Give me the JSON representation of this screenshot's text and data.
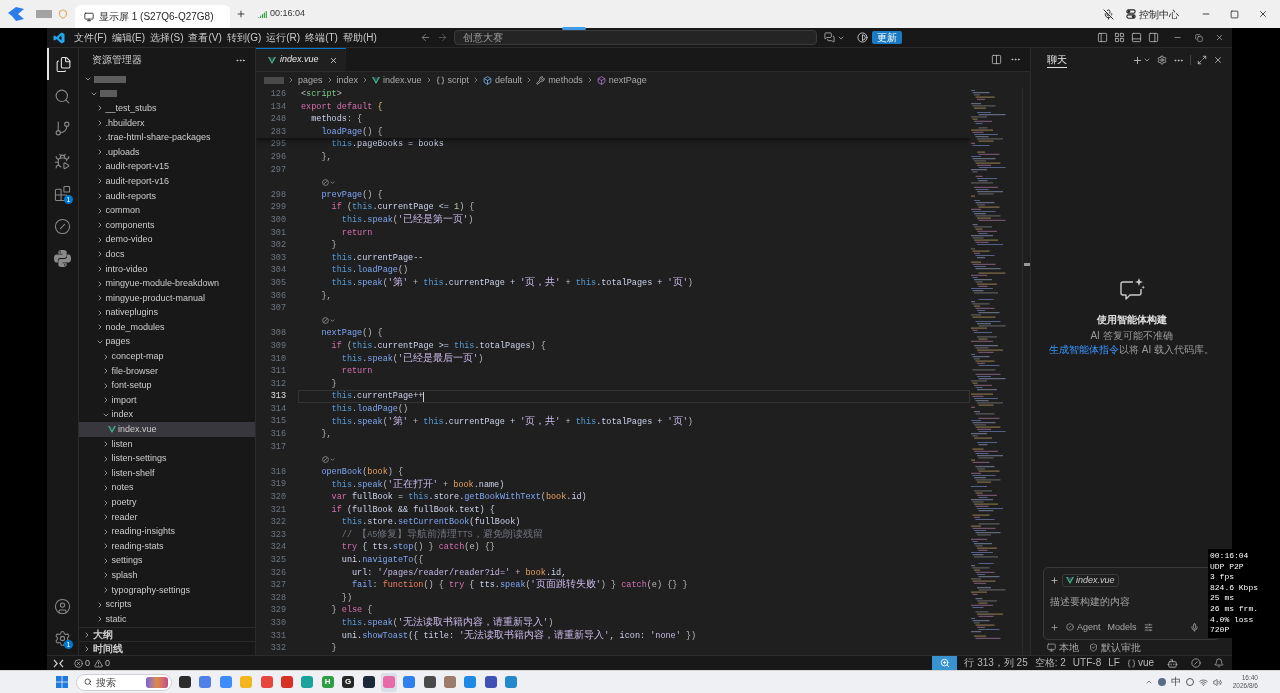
{
  "remote_bar": {
    "tabs": [
      {
        "label": "显示屏 1 (S27Q6-Q27G8)",
        "selected": true
      }
    ],
    "session_time": "00:16:04",
    "control_center": "控制中心"
  },
  "title_bar": {
    "menus": [
      "文件(F)",
      "编辑(E)",
      "选择(S)",
      "查看(V)",
      "转到(G)",
      "运行(R)",
      "终端(T)",
      "帮助(H)"
    ],
    "command_center": "创意大赛",
    "update_button": "更新"
  },
  "activity_bar": {
    "items": [
      {
        "kind": "explorer",
        "selected": true
      },
      {
        "kind": "search",
        "selected": false
      },
      {
        "kind": "source_control",
        "selected": false
      },
      {
        "kind": "run_debug",
        "selected": false
      },
      {
        "kind": "extensions",
        "selected": false,
        "badge": "1"
      },
      {
        "kind": "remote",
        "selected": false
      },
      {
        "kind": "python",
        "selected": false
      }
    ],
    "bottom_items": [
      {
        "kind": "account"
      },
      {
        "kind": "settings",
        "badge": "1"
      }
    ]
  },
  "explorer": {
    "title": "资源管理器",
    "tree": [
      {
        "kind": "redacted_folder",
        "expanded": true,
        "selected": false,
        "children": [
          {
            "kind": "redacted_folder",
            "expanded": true,
            "selected": false,
            "children": [
              {
                "label": "__test_stubs",
                "kind": "folder",
                "expanded": false,
                "selected": false
              },
              {
                "label": ".hbuilderx",
                "kind": "folder",
                "expanded": false,
                "selected": false
              },
              {
                "label": ".trae-html-share-packages",
                "kind": "folder",
                "expanded": false,
                "selected": false
              },
              {
                "label": ".uploads",
                "kind": "folder",
                "expanded": false,
                "selected": false
              },
              {
                "label": "audit-report-v15",
                "kind": "folder",
                "expanded": false,
                "selected": false
              },
              {
                "label": "audit-report-v16",
                "kind": "folder",
                "expanded": false,
                "selected": false
              },
              {
                "label": "audit-reports",
                "kind": "folder",
                "expanded": false,
                "selected": false
              },
              {
                "label": "common",
                "kind": "folder",
                "expanded": false,
                "selected": false
              },
              {
                "label": "components",
                "kind": "folder",
                "expanded": false,
                "selected": false
              },
              {
                "label": "demo-video",
                "kind": "folder",
                "expanded": false,
                "selected": false
              },
              {
                "label": "docs",
                "kind": "folder",
                "expanded": false,
                "selected": false
              },
              {
                "label": "intro-video",
                "kind": "folder",
                "expanded": false,
                "selected": false
              },
              {
                "label": "mingyue-module-breakdown",
                "kind": "folder",
                "expanded": false,
                "selected": false
              },
              {
                "label": "mingyue-product-manual",
                "kind": "folder",
                "expanded": false,
                "selected": false
              },
              {
                "label": "nativeplugins",
                "kind": "folder",
                "expanded": false,
                "selected": false
              },
              {
                "label": "node_modules",
                "kind": "folder",
                "expanded": false,
                "selected": false
              },
              {
                "label": "pages",
                "kind": "folder",
                "expanded": true,
                "selected": false,
                "children": [
                  {
                    "label": "concept-map",
                    "kind": "folder",
                    "expanded": false,
                    "selected": false
                  },
                  {
                    "label": "file-browser",
                    "kind": "folder",
                    "expanded": false,
                    "selected": false
                  },
                  {
                    "label": "font-setup",
                    "kind": "folder",
                    "expanded": false,
                    "selected": false
                  },
                  {
                    "label": "import",
                    "kind": "folder",
                    "expanded": false,
                    "selected": false
                  },
                  {
                    "label": "index",
                    "kind": "folder",
                    "expanded": true,
                    "selected": false,
                    "children": [
                      {
                        "label": "index.vue",
                        "kind": "vue_file",
                        "selected": true
                      }
                    ]
                  },
                  {
                    "label": "listen",
                    "kind": "folder",
                    "expanded": false,
                    "selected": false
                  },
                  {
                    "label": "listen-settings",
                    "kind": "folder",
                    "expanded": false,
                    "selected": false
                  },
                  {
                    "label": "listen-shelf",
                    "kind": "folder",
                    "expanded": false,
                    "selected": false
                  },
                  {
                    "label": "notes",
                    "kind": "folder",
                    "expanded": false,
                    "selected": false
                  },
                  {
                    "label": "poetry",
                    "kind": "folder",
                    "expanded": false,
                    "selected": false
                  },
                  {
                    "label": "reader",
                    "kind": "folder",
                    "expanded": false,
                    "selected": false
                  },
                  {
                    "label": "reading-insights",
                    "kind": "folder",
                    "expanded": false,
                    "selected": false
                  },
                  {
                    "label": "reading-stats",
                    "kind": "folder",
                    "expanded": false,
                    "selected": false
                  },
                  {
                    "label": "settings",
                    "kind": "folder",
                    "expanded": false,
                    "selected": false
                  },
                  {
                    "label": "splash",
                    "kind": "folder",
                    "expanded": false,
                    "selected": false
                  },
                  {
                    "label": "typography-settings",
                    "kind": "folder",
                    "expanded": false,
                    "selected": false
                  }
                ]
              },
              {
                "label": "scripts",
                "kind": "folder",
                "expanded": false,
                "selected": false
              },
              {
                "label": "static",
                "kind": "folder",
                "expanded": false,
                "selected": false
              }
            ]
          }
        ]
      }
    ],
    "sections": [
      {
        "label": "大纲",
        "expanded": false
      },
      {
        "label": "时间线",
        "expanded": false
      }
    ]
  },
  "editor": {
    "tabs": [
      {
        "label": "index.vue",
        "kind": "vue",
        "selected": true,
        "preview": true
      }
    ],
    "breadcrumbs": [
      {
        "kind": "redacted"
      },
      {
        "kind": "folder",
        "label": "pages"
      },
      {
        "kind": "folder",
        "label": "index"
      },
      {
        "kind": "vue",
        "label": "index.vue"
      },
      {
        "kind": "braces",
        "label": "script"
      },
      {
        "kind": "module",
        "label": "default"
      },
      {
        "kind": "property",
        "label": "methods"
      },
      {
        "kind": "method",
        "label": "nextPage"
      }
    ],
    "sticky_lines": [
      {
        "kind": "code",
        "number": "126",
        "current": false,
        "tokens": [
          {
            "text": "<",
            "kind": "op"
          },
          {
            "text": "script",
            "kind": "tag"
          },
          {
            "text": ">",
            "kind": "op"
          }
        ]
      },
      {
        "kind": "code",
        "number": "134",
        "current": false,
        "tokens": [
          {
            "text": "export default",
            "kind": "kw"
          },
          {
            "text": " {",
            "kind": "brace"
          }
        ]
      },
      {
        "kind": "code",
        "number": "248",
        "current": false,
        "tokens": [
          {
            "text": "  methods",
            "kind": "prop"
          },
          {
            "text": ": {",
            "kind": "op"
          }
        ]
      },
      {
        "kind": "code",
        "number": "283",
        "current": false,
        "tokens": [
          {
            "text": "    loadPage",
            "kind": "fn"
          },
          {
            "text": "() {",
            "kind": "op"
          }
        ]
      }
    ],
    "lines": [
      {
        "kind": "code",
        "number": "295",
        "current": false,
        "tokens": [
          {
            "text": "      this",
            "kind": "this"
          },
          {
            "text": ".pageBooks = books",
            "kind": "prop"
          }
        ]
      },
      {
        "kind": "code",
        "number": "296",
        "current": false,
        "tokens": [
          {
            "text": "    },",
            "kind": "op"
          }
        ]
      },
      {
        "kind": "code",
        "number": "297",
        "current": false
      },
      {
        "kind": "lens"
      },
      {
        "kind": "code",
        "number": "298",
        "current": false,
        "tokens": [
          {
            "text": "    prevPage",
            "kind": "fn"
          },
          {
            "text": "() {",
            "kind": "op"
          }
        ]
      },
      {
        "kind": "code",
        "number": "299",
        "current": false,
        "tokens": [
          {
            "text": "      if",
            "kind": "kw"
          },
          {
            "text": " (",
            "kind": "op"
          },
          {
            "text": "this",
            "kind": "this"
          },
          {
            "text": ".currentPage <= ",
            "kind": "prop"
          },
          {
            "text": "1",
            "kind": "num"
          },
          {
            "text": ") {",
            "kind": "op"
          }
        ]
      },
      {
        "kind": "code",
        "number": "300",
        "current": false,
        "tokens": [
          {
            "text": "        this",
            "kind": "this"
          },
          {
            "text": ".",
            "kind": "op"
          },
          {
            "text": "speak",
            "kind": "fn"
          },
          {
            "text": "(",
            "kind": "op"
          },
          {
            "text": "'已经是第一页'",
            "kind": "str"
          },
          {
            "text": ")",
            "kind": "op"
          }
        ]
      },
      {
        "kind": "code",
        "number": "301",
        "current": false,
        "tokens": [
          {
            "text": "        return",
            "kind": "kw"
          }
        ]
      },
      {
        "kind": "code",
        "number": "302",
        "current": false,
        "tokens": [
          {
            "text": "      }",
            "kind": "op"
          }
        ]
      },
      {
        "kind": "code",
        "number": "303",
        "current": false,
        "tokens": [
          {
            "text": "      this",
            "kind": "this"
          },
          {
            "text": ".currentPage--",
            "kind": "prop"
          }
        ]
      },
      {
        "kind": "code",
        "number": "304",
        "current": false,
        "tokens": [
          {
            "text": "      this",
            "kind": "this"
          },
          {
            "text": ".",
            "kind": "op"
          },
          {
            "text": "loadPage",
            "kind": "fn"
          },
          {
            "text": "()",
            "kind": "op"
          }
        ]
      },
      {
        "kind": "code",
        "number": "305",
        "current": false,
        "tokens": [
          {
            "text": "      this",
            "kind": "this"
          },
          {
            "text": ".",
            "kind": "op"
          },
          {
            "text": "speak",
            "kind": "fn"
          },
          {
            "text": "(",
            "kind": "op"
          },
          {
            "text": "'第'",
            "kind": "str"
          },
          {
            "text": " + ",
            "kind": "op"
          },
          {
            "text": "this",
            "kind": "this"
          },
          {
            "text": ".currentPage + ",
            "kind": "prop"
          },
          {
            "text": "'页，共'",
            "kind": "str"
          },
          {
            "text": " + ",
            "kind": "op"
          },
          {
            "text": "this",
            "kind": "this"
          },
          {
            "text": ".totalPages + ",
            "kind": "prop"
          },
          {
            "text": "'页'",
            "kind": "str"
          },
          {
            "text": ")",
            "kind": "op"
          }
        ]
      },
      {
        "kind": "code",
        "number": "306",
        "current": false,
        "tokens": [
          {
            "text": "    },",
            "kind": "op"
          }
        ]
      },
      {
        "kind": "code",
        "number": "307",
        "current": false
      },
      {
        "kind": "lens"
      },
      {
        "kind": "code",
        "number": "308",
        "current": false,
        "tokens": [
          {
            "text": "    nextPage",
            "kind": "fn"
          },
          {
            "text": "() {",
            "kind": "op"
          }
        ]
      },
      {
        "kind": "code",
        "number": "309",
        "current": false,
        "tokens": [
          {
            "text": "      if",
            "kind": "kw"
          },
          {
            "text": " (",
            "kind": "op"
          },
          {
            "text": "this",
            "kind": "this"
          },
          {
            "text": ".currentPage >= ",
            "kind": "prop"
          },
          {
            "text": "this",
            "kind": "this"
          },
          {
            "text": ".totalPages",
            "kind": "prop"
          },
          {
            "text": ") {",
            "kind": "op"
          }
        ]
      },
      {
        "kind": "code",
        "number": "310",
        "current": false,
        "tokens": [
          {
            "text": "        this",
            "kind": "this"
          },
          {
            "text": ".",
            "kind": "op"
          },
          {
            "text": "speak",
            "kind": "fn"
          },
          {
            "text": "(",
            "kind": "op"
          },
          {
            "text": "'已经是最后一页'",
            "kind": "str"
          },
          {
            "text": ")",
            "kind": "op"
          }
        ]
      },
      {
        "kind": "code",
        "number": "311",
        "current": false,
        "tokens": [
          {
            "text": "        return",
            "kind": "kw"
          }
        ]
      },
      {
        "kind": "code",
        "number": "312",
        "current": false,
        "tokens": [
          {
            "text": "      }",
            "kind": "op"
          }
        ]
      },
      {
        "kind": "code",
        "number": "313",
        "current": true,
        "tokens": [
          {
            "text": "      this",
            "kind": "this"
          },
          {
            "text": ".currentPage++",
            "kind": "prop"
          }
        ]
      },
      {
        "kind": "code",
        "number": "314",
        "current": false,
        "tokens": [
          {
            "text": "      this",
            "kind": "this"
          },
          {
            "text": ".",
            "kind": "op"
          },
          {
            "text": "loadPage",
            "kind": "fn"
          },
          {
            "text": "()",
            "kind": "op"
          }
        ]
      },
      {
        "kind": "code",
        "number": "315",
        "current": false,
        "tokens": [
          {
            "text": "      this",
            "kind": "this"
          },
          {
            "text": ".",
            "kind": "op"
          },
          {
            "text": "speak",
            "kind": "fn"
          },
          {
            "text": "(",
            "kind": "op"
          },
          {
            "text": "'第'",
            "kind": "str"
          },
          {
            "text": " + ",
            "kind": "op"
          },
          {
            "text": "this",
            "kind": "this"
          },
          {
            "text": ".currentPage + ",
            "kind": "prop"
          },
          {
            "text": "'页，共'",
            "kind": "str"
          },
          {
            "text": " + ",
            "kind": "op"
          },
          {
            "text": "this",
            "kind": "this"
          },
          {
            "text": ".totalPages + ",
            "kind": "prop"
          },
          {
            "text": "'页'",
            "kind": "str"
          },
          {
            "text": ")",
            "kind": "op"
          }
        ]
      },
      {
        "kind": "code",
        "number": "316",
        "current": false,
        "tokens": [
          {
            "text": "    },",
            "kind": "op"
          }
        ]
      },
      {
        "kind": "code",
        "number": "317",
        "current": false
      },
      {
        "kind": "lens"
      },
      {
        "kind": "code",
        "number": "318",
        "current": false,
        "tokens": [
          {
            "text": "    openBook",
            "kind": "fn"
          },
          {
            "text": "(",
            "kind": "op"
          },
          {
            "text": "book",
            "kind": "param"
          },
          {
            "text": ") {",
            "kind": "op"
          }
        ]
      },
      {
        "kind": "code",
        "number": "319",
        "current": false,
        "tokens": [
          {
            "text": "      this",
            "kind": "this"
          },
          {
            "text": ".",
            "kind": "op"
          },
          {
            "text": "speak",
            "kind": "fn"
          },
          {
            "text": "(",
            "kind": "op"
          },
          {
            "text": "'正在打开'",
            "kind": "str"
          },
          {
            "text": " + ",
            "kind": "op"
          },
          {
            "text": "book",
            "kind": "param"
          },
          {
            "text": ".name)",
            "kind": "prop"
          }
        ]
      },
      {
        "kind": "code",
        "number": "320",
        "current": false,
        "tokens": [
          {
            "text": "      var",
            "kind": "kw"
          },
          {
            "text": " fullBook = ",
            "kind": "prop"
          },
          {
            "text": "this",
            "kind": "this"
          },
          {
            "text": ".store.",
            "kind": "prop"
          },
          {
            "text": "getBookWithText",
            "kind": "fn"
          },
          {
            "text": "(",
            "kind": "op"
          },
          {
            "text": "book",
            "kind": "param"
          },
          {
            "text": ".id)",
            "kind": "prop"
          }
        ]
      },
      {
        "kind": "code",
        "number": "321",
        "current": false,
        "tokens": [
          {
            "text": "      if",
            "kind": "kw"
          },
          {
            "text": " (fullBook && fullBook.text) {",
            "kind": "prop"
          }
        ]
      },
      {
        "kind": "code",
        "number": "322",
        "current": false,
        "tokens": [
          {
            "text": "        this",
            "kind": "this"
          },
          {
            "text": ".store.",
            "kind": "prop"
          },
          {
            "text": "setCurrentBook",
            "kind": "fn"
          },
          {
            "text": "(fullBook)",
            "kind": "prop"
          }
        ]
      },
      {
        "kind": "code",
        "number": "323",
        "current": false,
        "tokens": [
          {
            "text": "        // 【A5修复】导航前清理TTS，避免朗读残留",
            "kind": "comment"
          }
        ]
      },
      {
        "kind": "code",
        "number": "324",
        "current": false,
        "tokens": [
          {
            "text": "        try",
            "kind": "kw"
          },
          {
            "text": " { tts.",
            "kind": "prop"
          },
          {
            "text": "stop",
            "kind": "fn"
          },
          {
            "text": "() } ",
            "kind": "op"
          },
          {
            "text": "catch",
            "kind": "kw"
          },
          {
            "text": "(e) {}",
            "kind": "op"
          }
        ]
      },
      {
        "kind": "code",
        "number": "325",
        "current": false,
        "tokens": [
          {
            "text": "        uni.",
            "kind": "prop"
          },
          {
            "text": "navigateTo",
            "kind": "fn"
          },
          {
            "text": "({",
            "kind": "op"
          }
        ]
      },
      {
        "kind": "code",
        "number": "326",
        "current": false,
        "tokens": [
          {
            "text": "          url: ",
            "kind": "prop"
          },
          {
            "text": "'/pages/reader/reader?id='",
            "kind": "str"
          },
          {
            "text": " + ",
            "kind": "op"
          },
          {
            "text": "book",
            "kind": "param"
          },
          {
            "text": ".id,",
            "kind": "prop"
          }
        ]
      },
      {
        "kind": "code",
        "number": "327",
        "current": false,
        "tokens": [
          {
            "text": "          fail",
            "kind": "fn"
          },
          {
            "text": ": ",
            "kind": "op"
          },
          {
            "text": "function",
            "kind": "storage"
          },
          {
            "text": "() { ",
            "kind": "op"
          },
          {
            "text": "try",
            "kind": "kw"
          },
          {
            "text": " { tts.",
            "kind": "prop"
          },
          {
            "text": "speak",
            "kind": "fn"
          },
          {
            "text": "(",
            "kind": "op"
          },
          {
            "text": "'页面跳转失败'",
            "kind": "str"
          },
          {
            "text": ") } ",
            "kind": "op"
          },
          {
            "text": "catch",
            "kind": "kw"
          },
          {
            "text": "(e) {} }",
            "kind": "op"
          }
        ]
      },
      {
        "kind": "code",
        "number": "328",
        "current": false,
        "tokens": [
          {
            "text": "        })",
            "kind": "op"
          }
        ]
      },
      {
        "kind": "code",
        "number": "329",
        "current": false,
        "tokens": [
          {
            "text": "      } ",
            "kind": "op"
          },
          {
            "text": "else",
            "kind": "kw"
          },
          {
            "text": " {",
            "kind": "op"
          }
        ]
      },
      {
        "kind": "code",
        "number": "330",
        "current": false,
        "tokens": [
          {
            "text": "        this",
            "kind": "this"
          },
          {
            "text": ".",
            "kind": "op"
          },
          {
            "text": "speak",
            "kind": "fn"
          },
          {
            "text": "(",
            "kind": "op"
          },
          {
            "text": "'无法读取书籍内容，请重新导入'",
            "kind": "str"
          },
          {
            "text": ")",
            "kind": "op"
          }
        ]
      },
      {
        "kind": "code",
        "number": "331",
        "current": false,
        "tokens": [
          {
            "text": "        uni.",
            "kind": "prop"
          },
          {
            "text": "showToast",
            "kind": "fn"
          },
          {
            "text": "({ title: ",
            "kind": "prop"
          },
          {
            "text": "'无法读取书籍内容，请重新导入'",
            "kind": "str"
          },
          {
            "text": ", icon: ",
            "kind": "prop"
          },
          {
            "text": "'none'",
            "kind": "str"
          },
          {
            "text": " })",
            "kind": "op"
          }
        ]
      },
      {
        "kind": "code",
        "number": "332",
        "current": false,
        "tokens": [
          {
            "text": "      }",
            "kind": "op"
          }
        ]
      }
    ]
  },
  "chat": {
    "tabs": [
      {
        "label": "聊天",
        "selected": true
      }
    ],
    "empty_state": {
      "title": "使用智能体构建",
      "note": "AI 答复可能不准确",
      "link": "生成智能体指令",
      "link_suffix": "以将 AI 载入代码库。"
    },
    "composer": {
      "attachment": "index.vue",
      "placeholder": "描述要构建的内容",
      "mode": "Agent",
      "models": "Models"
    },
    "footer": [
      {
        "kind": "local",
        "label": "本地"
      },
      {
        "kind": "approval",
        "label": "默认审批"
      }
    ]
  },
  "status_bar": {
    "errors": "0",
    "warnings": "0",
    "items": [
      "行 313，列 25",
      "空格: 2",
      "UTF-8",
      "LF"
    ],
    "language": "vue"
  },
  "stats_overlay": [
    "00:16:04",
    "UDP P2P",
    "3 fps",
    "824.6 Kbps",
    "25 ms",
    "26 ms frm.",
    "4.0% loss",
    "720P"
  ],
  "taskbar": {
    "search": {
      "placeholder": "搜索"
    },
    "apps": [
      {
        "color": "#2b2b2b",
        "selected": false
      },
      {
        "color": "#4f7fe8",
        "selected": false
      },
      {
        "color": "#3d8bfd",
        "selected": false
      },
      {
        "color": "#f2b51d",
        "selected": false
      },
      {
        "color": "#e8453c",
        "selected": false
      },
      {
        "color": "#d93025",
        "selected": false
      },
      {
        "color": "#1aa39a",
        "selected": false
      },
      {
        "color": "#2e9e44",
        "glyph": "H",
        "selected": false
      },
      {
        "color": "#262626",
        "glyph": "G",
        "selected": false
      },
      {
        "color": "#1b2838",
        "selected": false
      },
      {
        "color": "#e86aa8",
        "selected": true
      },
      {
        "color": "#2f80ed",
        "selected": false
      },
      {
        "color": "#4a4a4a",
        "selected": false
      },
      {
        "color": "#9c7b68",
        "selected": false
      },
      {
        "color": "#1e88e5",
        "selected": false
      },
      {
        "color": "#3f51b5",
        "selected": false
      },
      {
        "color": "#2489ca",
        "selected": false
      }
    ],
    "input_method": "中",
    "time": "16:40",
    "date": "2026/8/6"
  }
}
